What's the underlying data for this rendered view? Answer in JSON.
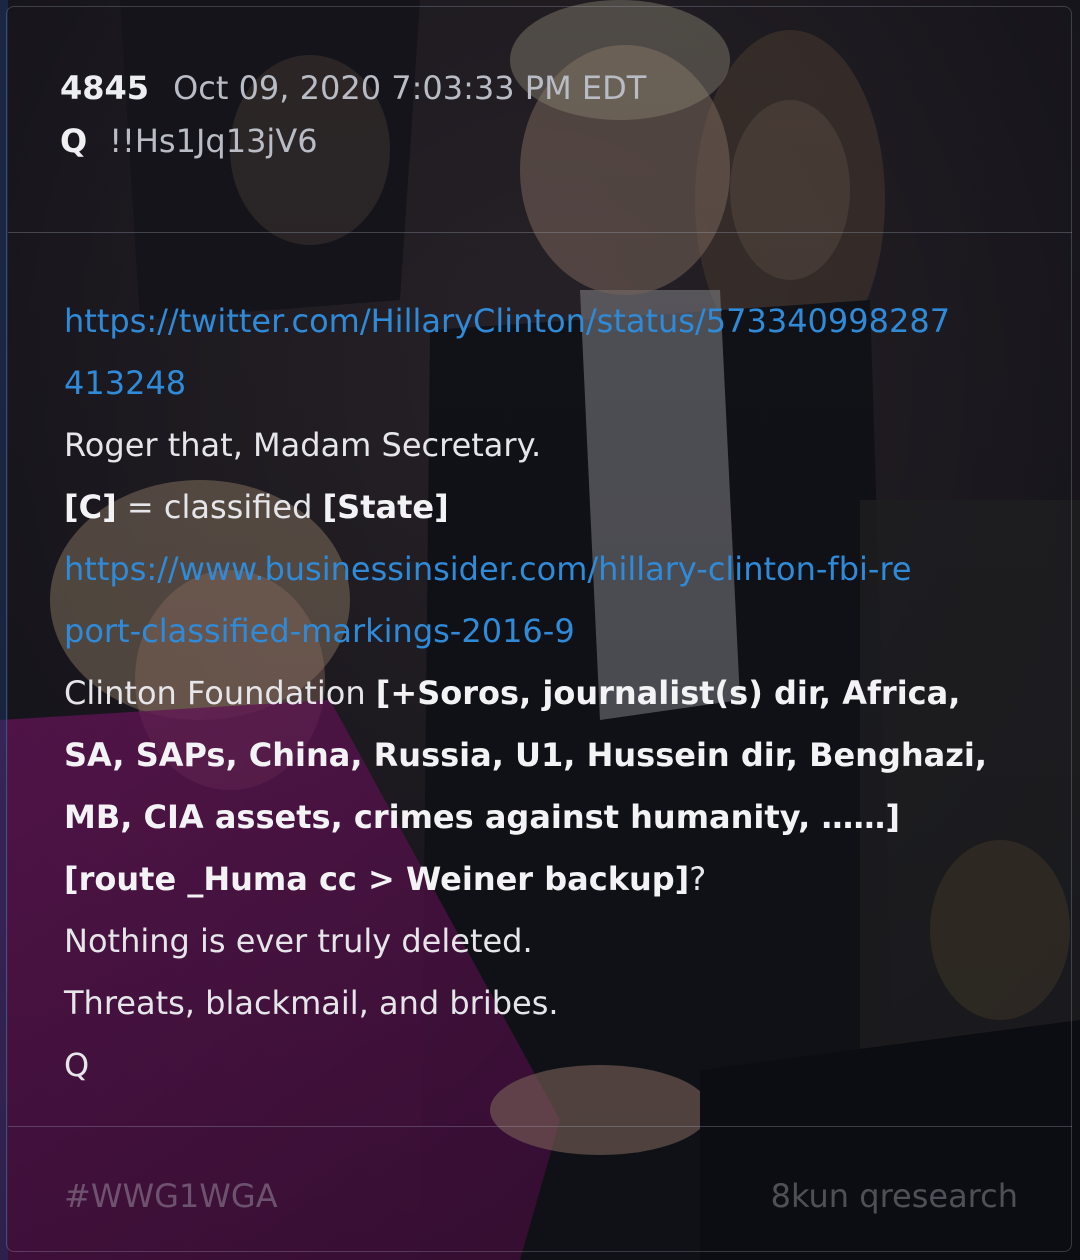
{
  "post": {
    "number": "4845",
    "date": "Oct 09, 2020 7:03:33 PM EDT",
    "author": "Q",
    "tripcode": "!!Hs1Jq13jV6"
  },
  "body": {
    "link1_line1": "https://twitter.com/HillaryClinton/status/573340998287",
    "link1_line2": "413248",
    "line_roger": "Roger that, Madam Secretary.",
    "line_c_bold1": "[C]",
    "line_c_mid": " = classified ",
    "line_c_bold2": "[State]",
    "link2_line1": "https://www.businessinsider.com/hillary-clinton-fbi-re",
    "link2_line2": "port-classified-markings-2016-9",
    "foundation_plain": "Clinton Foundation ",
    "foundation_bold1": "[+Soros, journalist(s) dir, Africa,",
    "foundation_bold2": "SA, SAPs, China, Russia, U1, Hussein dir, Benghazi,",
    "foundation_bold3": "MB, CIA assets, crimes against humanity, ……]",
    "route_bold": "[route _Huma cc > Weiner backup]",
    "route_tail": "?",
    "line_deleted": "Nothing is ever truly deleted.",
    "line_threats": "Threats, blackmail, and bribes.",
    "signature": "Q"
  },
  "footer": {
    "hashtag": "#WWG1WGA",
    "source": "8kun qresearch"
  },
  "colors": {
    "link": "#2f8ad8",
    "text": "#e6e6ea",
    "meta": "#b9bcc4",
    "background": "#0b0d12"
  }
}
